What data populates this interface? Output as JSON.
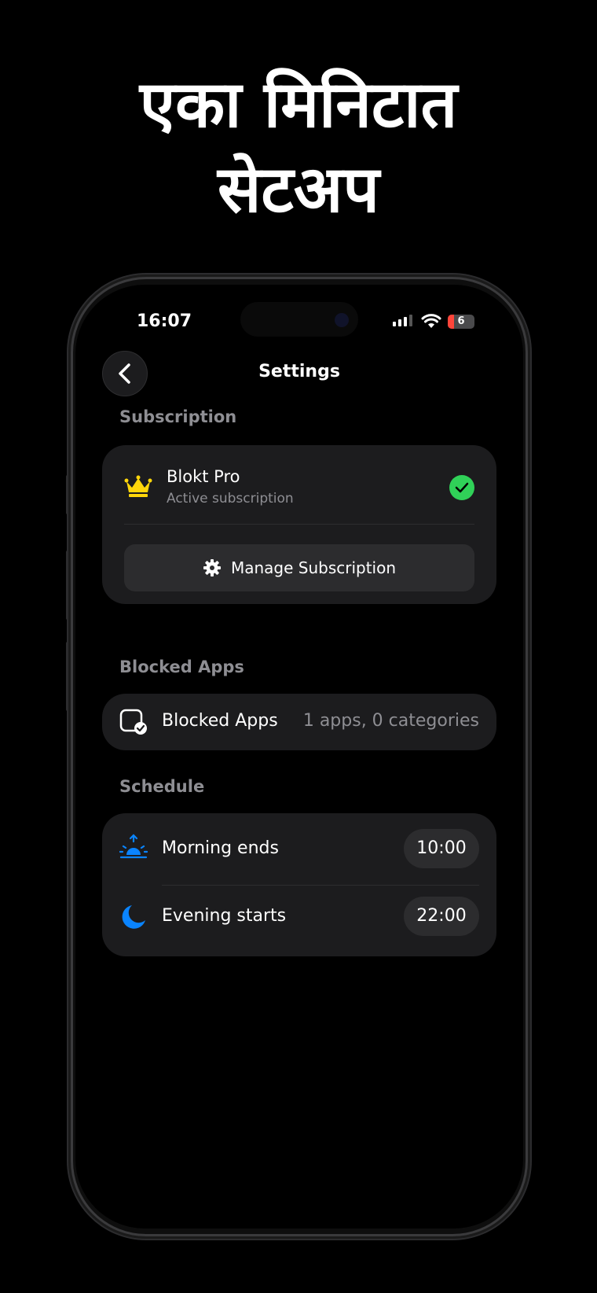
{
  "headline": {
    "line1": "एका मिनिटात",
    "line2": "सेटअप"
  },
  "status_bar": {
    "time": "16:07",
    "battery": "6"
  },
  "nav": {
    "title": "Settings"
  },
  "subscription": {
    "section_label": "Subscription",
    "plan_name": "Blokt Pro",
    "plan_status": "Active subscription",
    "manage_label": "Manage Subscription"
  },
  "blocked_apps": {
    "section_label": "Blocked Apps",
    "row_label": "Blocked Apps",
    "row_value": "1 apps, 0 categories"
  },
  "schedule": {
    "section_label": "Schedule",
    "morning_label": "Morning ends",
    "morning_time": "10:00",
    "evening_label": "Evening starts",
    "evening_time": "22:00"
  },
  "colors": {
    "accent_blue": "#0a84ff",
    "success_green": "#30d158",
    "crown_gold": "#ffd60a",
    "battery_low": "#ff453a"
  },
  "icons": [
    "back-chevron-icon",
    "crown-icon",
    "checkmark-icon",
    "gear-icon",
    "app-check-icon",
    "sunrise-icon",
    "moon-icon",
    "signal-icon",
    "wifi-icon",
    "battery-icon"
  ]
}
